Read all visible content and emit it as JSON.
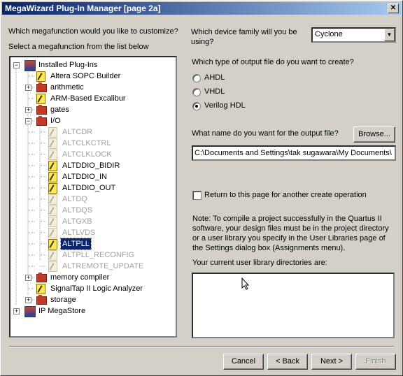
{
  "window": {
    "title": "MegaWizard Plug-In Manager [page 2a]",
    "close_symbol": "✕"
  },
  "left": {
    "question": "Which megafunction would you like to customize?",
    "instruction": "Select a megafunction from the list below"
  },
  "tree": [
    {
      "label": "Installed Plug-Ins",
      "depth": 0,
      "expander": "−",
      "icon": "plugins-root-icon",
      "state": "normal"
    },
    {
      "label": "Altera SOPC Builder",
      "depth": 1,
      "expander": "",
      "icon": "wizard-icon",
      "state": "normal"
    },
    {
      "label": "arithmetic",
      "depth": 1,
      "expander": "+",
      "icon": "folder-icon",
      "state": "normal"
    },
    {
      "label": "ARM-Based Excalibur",
      "depth": 1,
      "expander": "",
      "icon": "wizard-icon",
      "state": "normal"
    },
    {
      "label": "gates",
      "depth": 1,
      "expander": "+",
      "icon": "folder-icon",
      "state": "normal"
    },
    {
      "label": "I/O",
      "depth": 1,
      "expander": "−",
      "icon": "folder-icon",
      "state": "normal"
    },
    {
      "label": "ALTCDR",
      "depth": 2,
      "expander": "",
      "icon": "wizard-icon",
      "state": "disabled"
    },
    {
      "label": "ALTCLKCTRL",
      "depth": 2,
      "expander": "",
      "icon": "wizard-icon",
      "state": "disabled"
    },
    {
      "label": "ALTCLKLOCK",
      "depth": 2,
      "expander": "",
      "icon": "wizard-icon",
      "state": "disabled"
    },
    {
      "label": "ALTDDIO_BIDIR",
      "depth": 2,
      "expander": "",
      "icon": "wizard-icon",
      "state": "normal"
    },
    {
      "label": "ALTDDIO_IN",
      "depth": 2,
      "expander": "",
      "icon": "wizard-icon",
      "state": "normal"
    },
    {
      "label": "ALTDDIO_OUT",
      "depth": 2,
      "expander": "",
      "icon": "wizard-icon",
      "state": "normal"
    },
    {
      "label": "ALTDQ",
      "depth": 2,
      "expander": "",
      "icon": "wizard-icon",
      "state": "disabled"
    },
    {
      "label": "ALTDQS",
      "depth": 2,
      "expander": "",
      "icon": "wizard-icon",
      "state": "disabled"
    },
    {
      "label": "ALTGXB",
      "depth": 2,
      "expander": "",
      "icon": "wizard-icon",
      "state": "disabled"
    },
    {
      "label": "ALTLVDS",
      "depth": 2,
      "expander": "",
      "icon": "wizard-icon",
      "state": "disabled"
    },
    {
      "label": "ALTPLL",
      "depth": 2,
      "expander": "",
      "icon": "wizard-icon",
      "state": "selected"
    },
    {
      "label": "ALTPLL_RECONFIG",
      "depth": 2,
      "expander": "",
      "icon": "wizard-icon",
      "state": "disabled"
    },
    {
      "label": "ALTREMOTE_UPDATE",
      "depth": 2,
      "expander": "",
      "icon": "wizard-icon",
      "state": "disabled"
    },
    {
      "label": "memory compiler",
      "depth": 1,
      "expander": "+",
      "icon": "folder-icon",
      "state": "normal"
    },
    {
      "label": "SignalTap II Logic Analyzer",
      "depth": 1,
      "expander": "",
      "icon": "wizard-icon",
      "state": "normal"
    },
    {
      "label": "storage",
      "depth": 1,
      "expander": "+",
      "icon": "folder-icon",
      "state": "normal"
    },
    {
      "label": "IP MegaStore",
      "depth": 0,
      "expander": "+",
      "icon": "megastore-icon",
      "state": "normal"
    }
  ],
  "right": {
    "device_question": "Which device family will you be using?",
    "device_value": "Cyclone",
    "output_question": "Which type of output file do you want to create?",
    "output_options": [
      {
        "label": "AHDL",
        "selected": false
      },
      {
        "label": "VHDL",
        "selected": false
      },
      {
        "label": "Verilog HDL",
        "selected": true
      }
    ],
    "name_question": "What name do you want for the output file?",
    "browse_label": "Browse...",
    "output_path": "C:\\Documents and Settings\\tak sugawara\\My Documents\\",
    "return_checkbox_label": "Return to this page for another create operation",
    "note_text": "Note: To compile a project successfully in the Quartus II software, your design files must be in the project directory or a user library you specify in the User Libraries page of the Settings dialog box (Assignments menu).",
    "library_label": "Your current user library directories are:"
  },
  "footer": {
    "cancel_label": "Cancel",
    "back_label": "< Back",
    "next_label": "Next >",
    "finish_label": "Finish"
  }
}
